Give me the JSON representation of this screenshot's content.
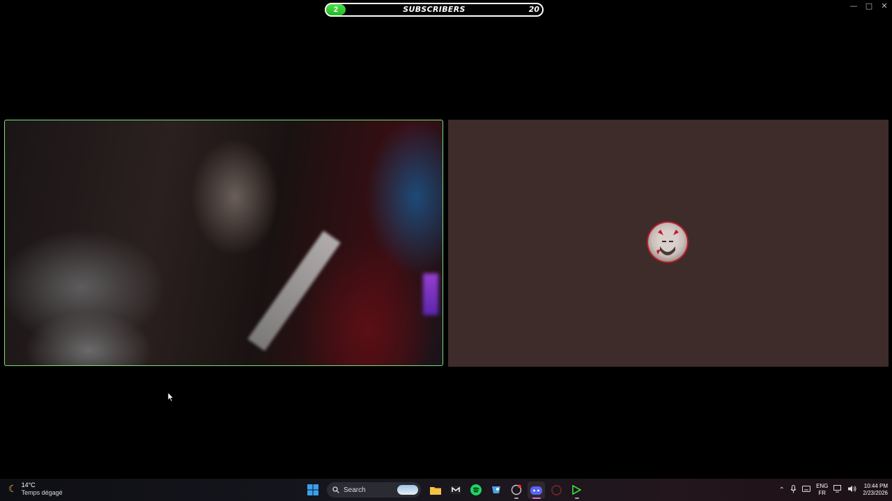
{
  "window_controls": {
    "minimize": "—",
    "maximize": "□",
    "close": "✕"
  },
  "subscriber_bar": {
    "current_count": "2",
    "label": "SUBSCRIBERS",
    "goal": "20",
    "progress_fraction": 0.1,
    "fill_color": "#2ec72e"
  },
  "video_tiles": [
    {
      "kind": "camera",
      "border_color": "#7de07d"
    },
    {
      "kind": "avatar",
      "background": "#3e2c2a",
      "ring_color": "#b91c2a"
    }
  ],
  "taskbar": {
    "weather": {
      "icon": "moon-icon",
      "temperature": "14°C",
      "condition": "Temps dégagé"
    },
    "search_placeholder": "Search",
    "pinned_apps": [
      "windows-start-icon",
      "file-explorer-icon",
      "media-app-icon",
      "spotify-icon",
      "steam-icon",
      "app-icon",
      "discord-icon",
      "recording-icon",
      "green-arrow-app-icon"
    ],
    "tray": {
      "language_primary": "ENG",
      "language_secondary": "FR",
      "time": "10:44 PM",
      "date": "2/23/2026"
    }
  }
}
